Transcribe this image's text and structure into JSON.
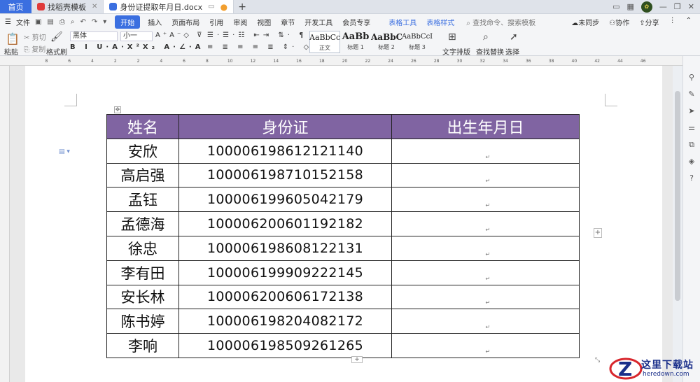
{
  "tabs": {
    "home": "首页",
    "template_tab": "找稻壳模板",
    "doc_tab": "身份证提取年月日.docx"
  },
  "menu": {
    "file": "文件",
    "items": [
      "开始",
      "插入",
      "页面布局",
      "引用",
      "审阅",
      "视图",
      "章节",
      "开发工具",
      "会员专享"
    ],
    "table_tools": "表格工具",
    "table_style": "表格样式",
    "search": "查找命令、搜索模板",
    "right": [
      "未同步",
      "协作",
      "分享"
    ]
  },
  "ribbon": {
    "cut": "剪切",
    "copy": "复制",
    "paste": "粘贴",
    "format_painter": "格式刷",
    "font_name": "黑体",
    "font_size": "小一",
    "styles": [
      {
        "preview": "AaBbCcDd",
        "name": "正文"
      },
      {
        "preview": "AaBb",
        "name": "标题 1"
      },
      {
        "preview": "AaBbC",
        "name": "标题 2"
      },
      {
        "preview": "AaBbCcI",
        "name": "标题 3"
      }
    ],
    "text_layout": "文字排版",
    "find_replace": "查找替换",
    "select": "选择"
  },
  "table": {
    "headers": [
      "姓名",
      "身份证",
      "出生年月日"
    ],
    "rows": [
      {
        "name": "安欣",
        "id": "100006198612121140",
        "birth": ""
      },
      {
        "name": "高启强",
        "id": "100006198710152158",
        "birth": ""
      },
      {
        "name": "孟钰",
        "id": "100006199605042179",
        "birth": ""
      },
      {
        "name": "孟德海",
        "id": "100006200601192182",
        "birth": ""
      },
      {
        "name": "徐忠",
        "id": "100006198608122131",
        "birth": ""
      },
      {
        "name": "李有田",
        "id": "100006199909222145",
        "birth": ""
      },
      {
        "name": "安长林",
        "id": "100006200606172138",
        "birth": ""
      },
      {
        "name": "陈书婷",
        "id": "100006198204082172",
        "birth": ""
      },
      {
        "name": "李响",
        "id": "100006198509261265",
        "birth": ""
      }
    ]
  },
  "watermark": {
    "line1": "这里下载站",
    "line2": "heredown.com"
  },
  "colors": {
    "header_bg": "#8064a2",
    "accent": "#3b6fe0"
  }
}
